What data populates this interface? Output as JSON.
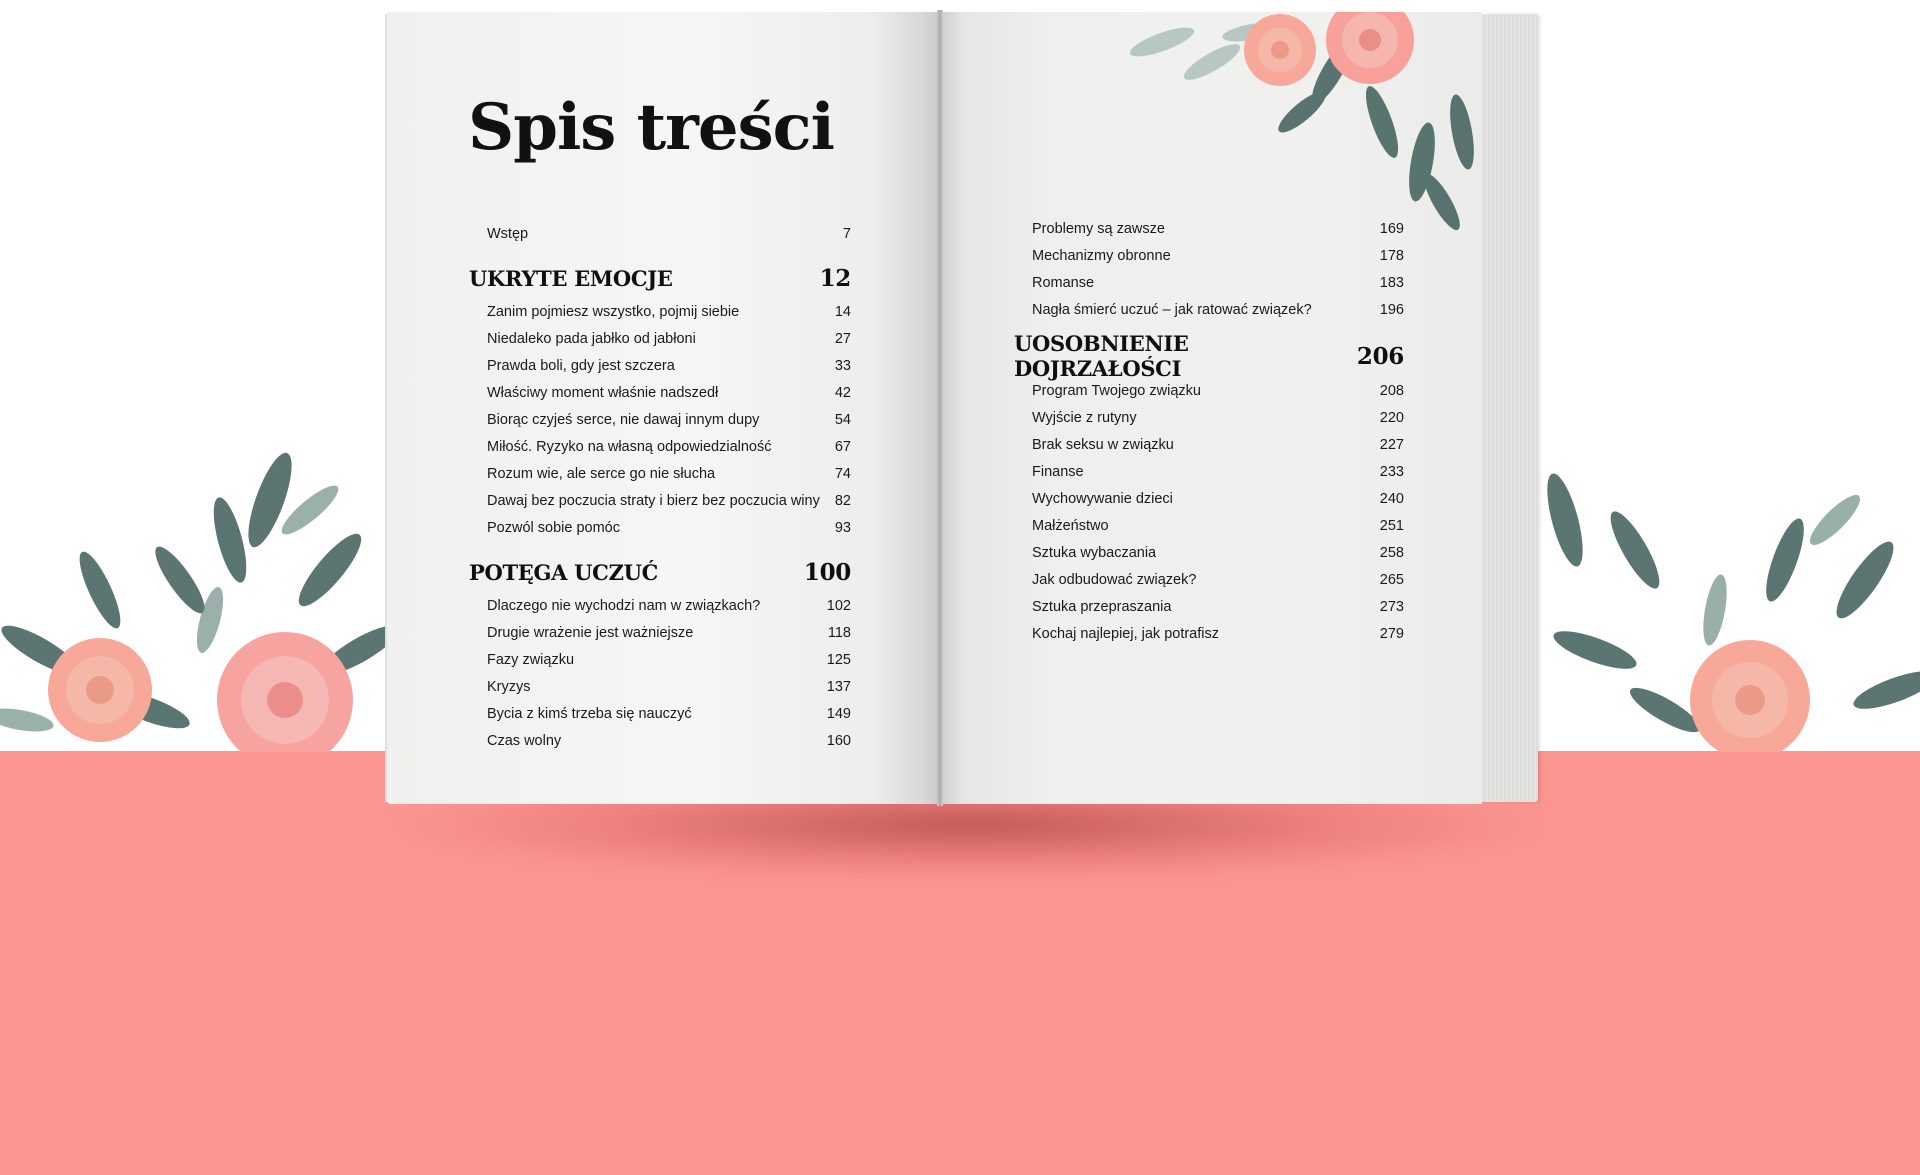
{
  "colors": {
    "background_top": "#ffffff",
    "background_bottom": "#fb9592",
    "page": "#f3f3f2",
    "text": "#1a1a1a",
    "rose": "#f8a898",
    "leaf": "#3f5f5a"
  },
  "toc": {
    "title": "Spis treści",
    "left": {
      "intro": {
        "label": "Wstęp",
        "page": "7"
      },
      "sections": [
        {
          "title": "UKRYTE EMOCJE",
          "page": "12",
          "entries": [
            {
              "label": "Zanim pojmiesz wszystko, pojmij siebie",
              "page": "14"
            },
            {
              "label": "Niedaleko pada jabłko od jabłoni",
              "page": "27"
            },
            {
              "label": "Prawda boli, gdy jest szczera",
              "page": "33"
            },
            {
              "label": "Właściwy moment właśnie nadszedł",
              "page": "42"
            },
            {
              "label": "Biorąc czyjeś serce, nie dawaj innym dupy",
              "page": "54"
            },
            {
              "label": "Miłość. Ryzyko na własną odpowiedzialność",
              "page": "67"
            },
            {
              "label": "Rozum wie, ale serce go nie słucha",
              "page": "74"
            },
            {
              "label": "Dawaj bez poczucia straty i bierz bez poczucia winy",
              "page": "82"
            },
            {
              "label": "Pozwól sobie pomóc",
              "page": "93"
            }
          ]
        },
        {
          "title": "POTĘGA UCZUĆ",
          "page": "100",
          "entries": [
            {
              "label": "Dlaczego nie wychodzi nam w związkach?",
              "page": "102"
            },
            {
              "label": "Drugie wrażenie jest ważniejsze",
              "page": "118"
            },
            {
              "label": "Fazy związku",
              "page": "125"
            },
            {
              "label": "Kryzys",
              "page": "137"
            },
            {
              "label": "Bycia z kimś trzeba się nauczyć",
              "page": "149"
            },
            {
              "label": "Czas wolny",
              "page": "160"
            }
          ]
        }
      ]
    },
    "right": {
      "continued": [
        {
          "label": "Problemy są zawsze",
          "page": "169"
        },
        {
          "label": "Mechanizmy obronne",
          "page": "178"
        },
        {
          "label": "Romanse",
          "page": "183"
        },
        {
          "label": "Nagła śmierć uczuć – jak ratować związek?",
          "page": "196"
        }
      ],
      "section": {
        "title": "UOSOBNIENIE DOJRZAŁOŚCI",
        "page": "206",
        "entries": [
          {
            "label": "Program Twojego związku",
            "page": "208"
          },
          {
            "label": "Wyjście z rutyny",
            "page": "220"
          },
          {
            "label": "Brak seksu w związku",
            "page": "227"
          },
          {
            "label": "Finanse",
            "page": "233"
          },
          {
            "label": "Wychowywanie dzieci",
            "page": "240"
          },
          {
            "label": "Małżeństwo",
            "page": "251"
          },
          {
            "label": "Sztuka wybaczania",
            "page": "258"
          },
          {
            "label": "Jak odbudować związek?",
            "page": "265"
          },
          {
            "label": "Sztuka przepraszania",
            "page": "273"
          },
          {
            "label": "Kochaj najlepiej, jak potrafisz",
            "page": "279"
          }
        ]
      }
    }
  }
}
